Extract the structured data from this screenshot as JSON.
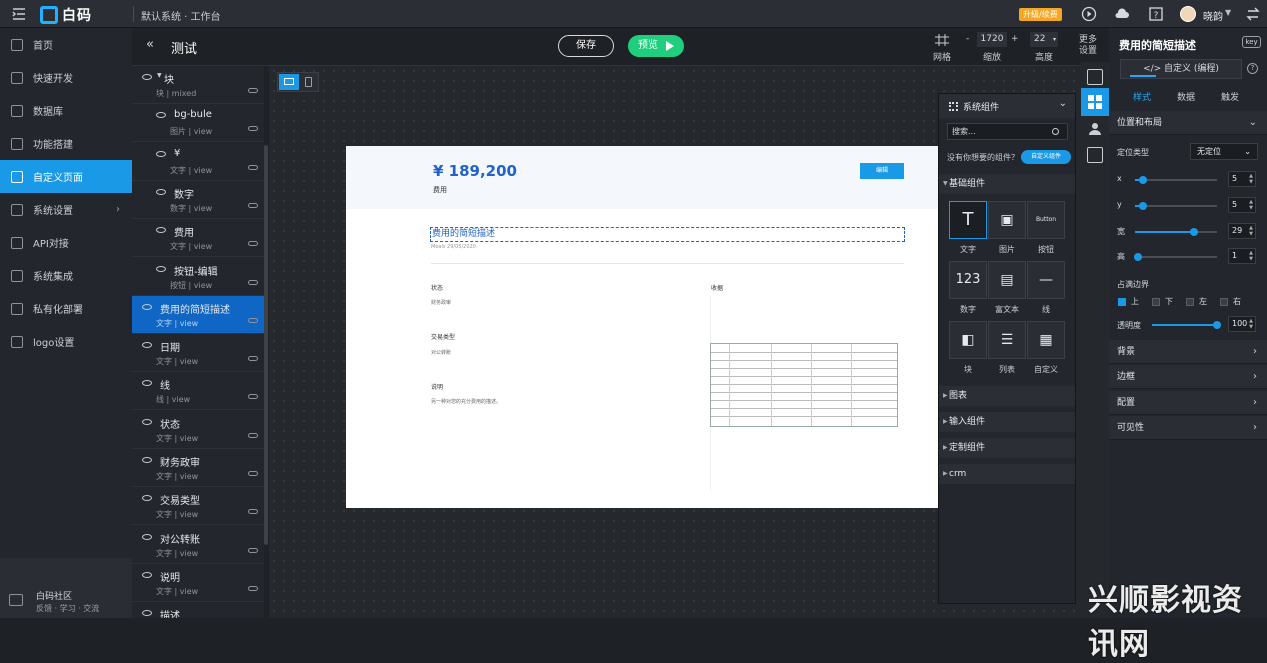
{
  "app": {
    "name": "白码",
    "breadcrumb": "默认系统 · 工作台",
    "upgrade": "升级/续费",
    "user": "晓韵"
  },
  "nav": [
    {
      "label": "首页"
    },
    {
      "label": "快速开发"
    },
    {
      "label": "数据库"
    },
    {
      "label": "功能搭建"
    },
    {
      "label": "自定义页面"
    },
    {
      "label": "系统设置"
    },
    {
      "label": "API对接"
    },
    {
      "label": "系统集成"
    },
    {
      "label": "私有化部署"
    },
    {
      "label": "logo设置"
    }
  ],
  "community": {
    "title": "白码社区",
    "subtitle": "反馈 · 学习 · 交流"
  },
  "layers_panel": {
    "back": "«",
    "title": "测试"
  },
  "layers": [
    {
      "name": "块",
      "type": "块",
      "view": "mixed"
    },
    {
      "name": "bg-bule",
      "type": "图片",
      "view": "view"
    },
    {
      "name": "¥",
      "type": "文字",
      "view": "view"
    },
    {
      "name": "数字",
      "type": "数字",
      "view": "view"
    },
    {
      "name": "费用",
      "type": "文字",
      "view": "view"
    },
    {
      "name": "按钮-编辑",
      "type": "按钮",
      "view": "view"
    },
    {
      "name": "费用的简短描述",
      "type": "文字",
      "view": "view"
    },
    {
      "name": "日期",
      "type": "文字",
      "view": "view"
    },
    {
      "name": "线",
      "type": "线",
      "view": "view"
    },
    {
      "name": "状态",
      "type": "文字",
      "view": "view"
    },
    {
      "name": "财务政审",
      "type": "文字",
      "view": "view"
    },
    {
      "name": "交易类型",
      "type": "文字",
      "view": "view"
    },
    {
      "name": "对公转账",
      "type": "文字",
      "view": "view"
    },
    {
      "name": "说明",
      "type": "文字",
      "view": "view"
    },
    {
      "name": "描述",
      "type": "",
      "view": ""
    }
  ],
  "toolbar": {
    "save": "保存",
    "preview": "预览",
    "grid_label": "网格",
    "zoom_value": "1720",
    "zoom_label": "缩放",
    "height_value": "22",
    "height_label": "高度",
    "more_label": "更多设置"
  },
  "page": {
    "amount": "¥ 189,200",
    "amount_label": "费用",
    "edit_button": "编辑",
    "description": "费用的简短描述",
    "date": "Meals 29/05/2020",
    "status_label": "状态",
    "status_value": "财务政审",
    "receipt_label": "收据",
    "trade_label": "交易类型",
    "trade_value": "对公转账",
    "note_label": "说明",
    "note_value": "另一种对您的充分费用的描述。"
  },
  "components": {
    "title": "系统组件",
    "search_placeholder": "搜索...",
    "ask": "没有你想要的组件？",
    "custom": "自定义组件",
    "sections": [
      "基础组件",
      "图表",
      "输入组件",
      "定制组件",
      "crm"
    ],
    "tiles": [
      {
        "label": "文字",
        "icon": "text-icon"
      },
      {
        "label": "图片",
        "icon": "image-icon"
      },
      {
        "label": "按钮",
        "icon": "button-icon",
        "glyph": "Button"
      },
      {
        "label": "数字",
        "icon": "number-icon",
        "glyph": "123"
      },
      {
        "label": "富文本",
        "icon": "richtext-icon"
      },
      {
        "label": "线",
        "icon": "line-icon"
      },
      {
        "label": "块",
        "icon": "block-icon"
      },
      {
        "label": "列表",
        "icon": "list-icon"
      },
      {
        "label": "自定义",
        "icon": "custom-icon"
      }
    ]
  },
  "props": {
    "title": "费用的简短描述",
    "key": "key",
    "custom_button": "</> 自定义 (编程)",
    "tabs": [
      "样式",
      "数据",
      "触发"
    ],
    "layout_section": "位置和布局",
    "position_label": "定位类型",
    "position_value": "无定位",
    "fields": [
      {
        "label": "x",
        "value": "5",
        "fill": 0.1
      },
      {
        "label": "y",
        "value": "5",
        "fill": 0.1
      },
      {
        "label": "宽",
        "value": "29",
        "fill": 0.72
      },
      {
        "label": "高",
        "value": "1",
        "fill": 0.04
      }
    ],
    "border_label": "占满边界",
    "border_opts": [
      {
        "label": "上",
        "checked": true
      },
      {
        "label": "下",
        "checked": false
      },
      {
        "label": "左",
        "checked": false
      },
      {
        "label": "右",
        "checked": false
      }
    ],
    "opacity_label": "透明度",
    "opacity_value": "100",
    "sections": [
      "背景",
      "边框",
      "配置",
      "可见性"
    ]
  },
  "watermark": "兴顺影视资讯网",
  "colors": {
    "accent": "#1a9ae6",
    "preview": "#1fcf7e",
    "amount": "#1f63c8"
  }
}
